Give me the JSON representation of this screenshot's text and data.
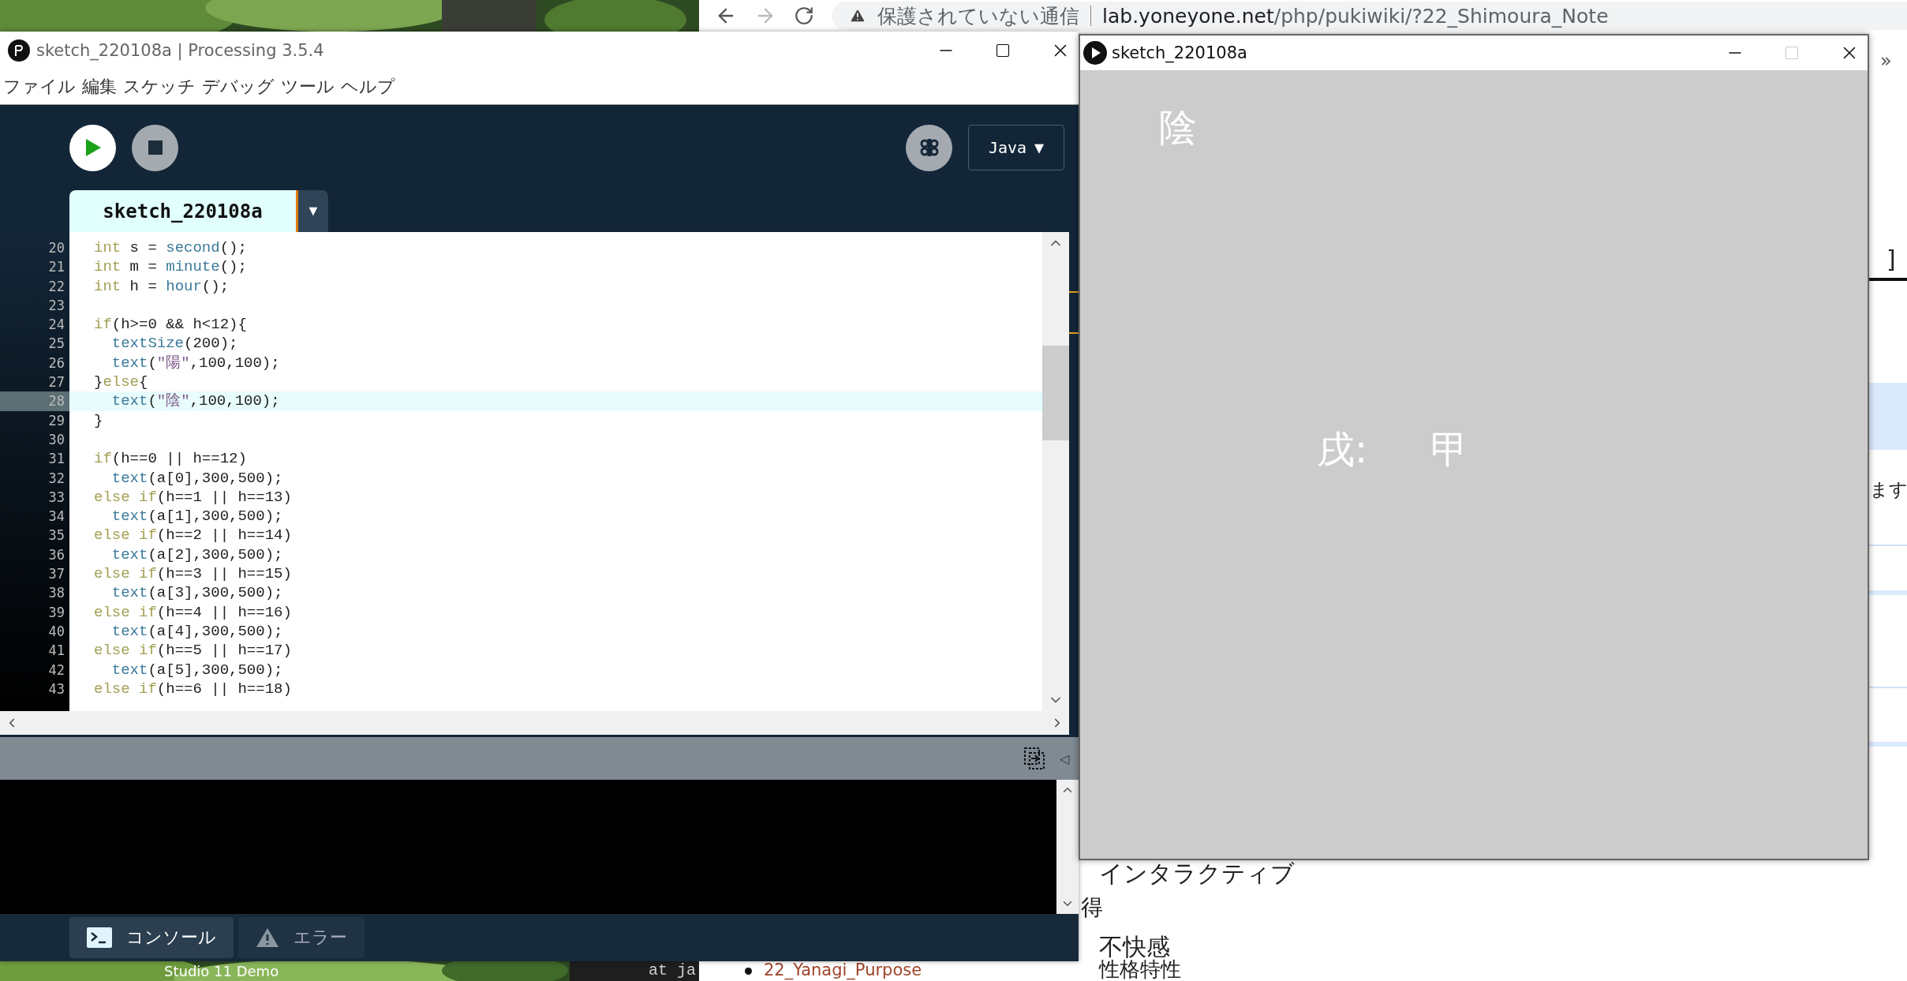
{
  "desktop": {
    "caption": "Studio 11 Demo",
    "terminal_text": "at ja"
  },
  "browser": {
    "forward_disabled": true,
    "security": "保護されていない通信",
    "url_domain": "lab.yoneyone.net",
    "url_path": "/php/pukiwiki/?22_Shimoura_Note",
    "overflow": "»",
    "heading_tail": "]",
    "text_tail": "ます",
    "items": [
      {
        "text": "インタラクティブ"
      },
      {
        "text": "得"
      },
      {
        "text": "不快感"
      },
      {
        "text": "性格特性"
      }
    ],
    "link": "22_Yanagi_Purpose"
  },
  "ide": {
    "title": "sketch_220108a | Processing 3.5.4",
    "menu": [
      "ファイル",
      "編集",
      "スケッチ",
      "デバッグ",
      "ツール",
      "ヘルプ"
    ],
    "mode": "Java",
    "mode_caret": "▼",
    "tab": {
      "label": "sketch_220108a",
      "selected": true
    },
    "tab_menu": "▼",
    "code_lines": [
      {
        "number": "20",
        "selected": false,
        "tokens": [
          {
            "kind": "kw",
            "text": "int"
          },
          {
            "kind": "plain",
            "text": " s = "
          },
          {
            "kind": "fn",
            "text": "second"
          },
          {
            "kind": "plain",
            "text": "();"
          }
        ]
      },
      {
        "number": "21",
        "selected": false,
        "tokens": [
          {
            "kind": "kw",
            "text": "int"
          },
          {
            "kind": "plain",
            "text": " m = "
          },
          {
            "kind": "fn",
            "text": "minute"
          },
          {
            "kind": "plain",
            "text": "();"
          }
        ]
      },
      {
        "number": "22",
        "selected": false,
        "tokens": [
          {
            "kind": "kw",
            "text": "int"
          },
          {
            "kind": "plain",
            "text": " h = "
          },
          {
            "kind": "fn",
            "text": "hour"
          },
          {
            "kind": "plain",
            "text": "();"
          }
        ]
      },
      {
        "number": "23",
        "selected": false
      },
      {
        "number": "24",
        "selected": false,
        "tokens": [
          {
            "kind": "kw",
            "text": "if"
          },
          {
            "kind": "plain",
            "text": "(h>=0 && h<12){"
          }
        ]
      },
      {
        "number": "25",
        "selected": false,
        "tokens": [
          {
            "kind": "fn",
            "text": "  textSize"
          },
          {
            "kind": "plain",
            "text": "(200);"
          }
        ]
      },
      {
        "number": "26",
        "selected": false,
        "tokens": [
          {
            "kind": "fn",
            "text": "  text"
          },
          {
            "kind": "plain",
            "text": "("
          },
          {
            "kind": "str",
            "text": "\"陽\""
          },
          {
            "kind": "plain",
            "text": ",100,100);"
          }
        ]
      },
      {
        "number": "27",
        "selected": false,
        "tokens": [
          {
            "kind": "plain",
            "text": "}"
          },
          {
            "kind": "kw",
            "text": "else"
          },
          {
            "kind": "plain",
            "text": "{"
          }
        ]
      },
      {
        "number": "28",
        "selected": true,
        "tokens": [
          {
            "kind": "fn",
            "text": "  text"
          },
          {
            "kind": "plain",
            "text": "("
          },
          {
            "kind": "str",
            "text": "\"陰\""
          },
          {
            "kind": "plain",
            "text": ",100,100);"
          }
        ]
      },
      {
        "number": "29",
        "selected": false,
        "tokens": [
          {
            "kind": "plain",
            "text": "}"
          }
        ]
      },
      {
        "number": "30",
        "selected": false
      },
      {
        "number": "31",
        "selected": false,
        "tokens": [
          {
            "kind": "kw",
            "text": "if"
          },
          {
            "kind": "plain",
            "text": "(h==0 || h==12)"
          }
        ]
      },
      {
        "number": "32",
        "selected": false,
        "tokens": [
          {
            "kind": "fn",
            "text": "  text"
          },
          {
            "kind": "plain",
            "text": "(a[0],300,500);"
          }
        ]
      },
      {
        "number": "33",
        "selected": false,
        "tokens": [
          {
            "kind": "kw",
            "text": "else if"
          },
          {
            "kind": "plain",
            "text": "(h==1 || h==13)"
          }
        ]
      },
      {
        "number": "34",
        "selected": false,
        "tokens": [
          {
            "kind": "fn",
            "text": "  text"
          },
          {
            "kind": "plain",
            "text": "(a[1],300,500);"
          }
        ]
      },
      {
        "number": "35",
        "selected": false,
        "tokens": [
          {
            "kind": "kw",
            "text": "else if"
          },
          {
            "kind": "plain",
            "text": "(h==2 || h==14)"
          }
        ]
      },
      {
        "number": "36",
        "selected": false,
        "tokens": [
          {
            "kind": "fn",
            "text": "  text"
          },
          {
            "kind": "plain",
            "text": "(a[2],300,500);"
          }
        ]
      },
      {
        "number": "37",
        "selected": false,
        "tokens": [
          {
            "kind": "kw",
            "text": "else if"
          },
          {
            "kind": "plain",
            "text": "(h==3 || h==15)"
          }
        ]
      },
      {
        "number": "38",
        "selected": false,
        "tokens": [
          {
            "kind": "fn",
            "text": "  text"
          },
          {
            "kind": "plain",
            "text": "(a[3],300,500);"
          }
        ]
      },
      {
        "number": "39",
        "selected": false,
        "tokens": [
          {
            "kind": "kw",
            "text": "else if"
          },
          {
            "kind": "plain",
            "text": "(h==4 || h==16)"
          }
        ]
      },
      {
        "number": "40",
        "selected": false,
        "tokens": [
          {
            "kind": "fn",
            "text": "  text"
          },
          {
            "kind": "plain",
            "text": "(a[4],300,500);"
          }
        ]
      },
      {
        "number": "41",
        "selected": false,
        "tokens": [
          {
            "kind": "kw",
            "text": "else if"
          },
          {
            "kind": "plain",
            "text": "(h==5 || h==17)"
          }
        ]
      },
      {
        "number": "42",
        "selected": false,
        "tokens": [
          {
            "kind": "fn",
            "text": "  text"
          },
          {
            "kind": "plain",
            "text": "(a[5],300,500);"
          }
        ]
      },
      {
        "number": "43",
        "selected": false,
        "tokens": [
          {
            "kind": "kw",
            "text": "else if"
          },
          {
            "kind": "plain",
            "text": "(h==6 || h==18)"
          }
        ]
      }
    ],
    "console_toggle": "◁",
    "console_tabs": [
      {
        "kind": "console",
        "label": "コンソール",
        "selected": true
      },
      {
        "kind": "error",
        "label": "エラー",
        "selected": false
      }
    ]
  },
  "sketch": {
    "title": "sketch_220108a",
    "maximize_disabled": true,
    "top_text": "陰",
    "middle_texts": [
      "戌:",
      "甲"
    ]
  }
}
